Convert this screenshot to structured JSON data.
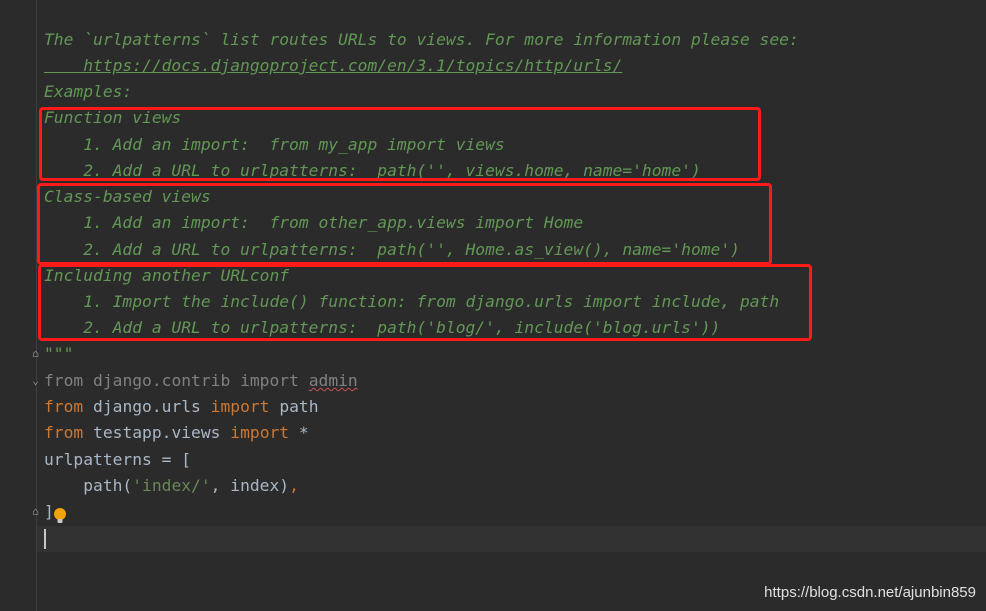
{
  "editor": {
    "doc_lines": [
      "The `urlpatterns` list routes URLs to views. For more information please see:",
      "    https://docs.djangoproject.com/en/3.1/topics/http/urls/",
      "Examples:",
      "Function views",
      "    1. Add an import:  from my_app import views",
      "    2. Add a URL to urlpatterns:  path('', views.home, name='home')",
      "Class-based views",
      "    1. Add an import:  from other_app.views import Home",
      "    2. Add a URL to urlpatterns:  path('', Home.as_view(), name='home')",
      "Including another URLconf",
      "    1. Import the include() function: from django.urls import include, path",
      "    2. Add a URL to urlpatterns:  path('blog/', include('blog.urls'))",
      "\"\"\""
    ],
    "code": {
      "l1_from": "from",
      "l1_module": "django.contrib",
      "l1_import": "import",
      "l1_name": "admin",
      "l2_from": "from",
      "l2_module": "django.urls",
      "l2_import": "import",
      "l2_name": "path",
      "l3_from": "from",
      "l3_module": "testapp.views",
      "l3_import": "import",
      "l3_name": "*",
      "l4_text": "urlpatterns = [",
      "l5_indent": "    path(",
      "l5_str": "'index/'",
      "l5_rest": ", index)",
      "l5_comma": ",",
      "l6_text": "]"
    }
  },
  "colors": {
    "highlight_box": "#ff1a1a",
    "docstring": "#629755",
    "keyword": "#cc7832"
  },
  "watermark": "https://blog.csdn.net/ajunbin859"
}
